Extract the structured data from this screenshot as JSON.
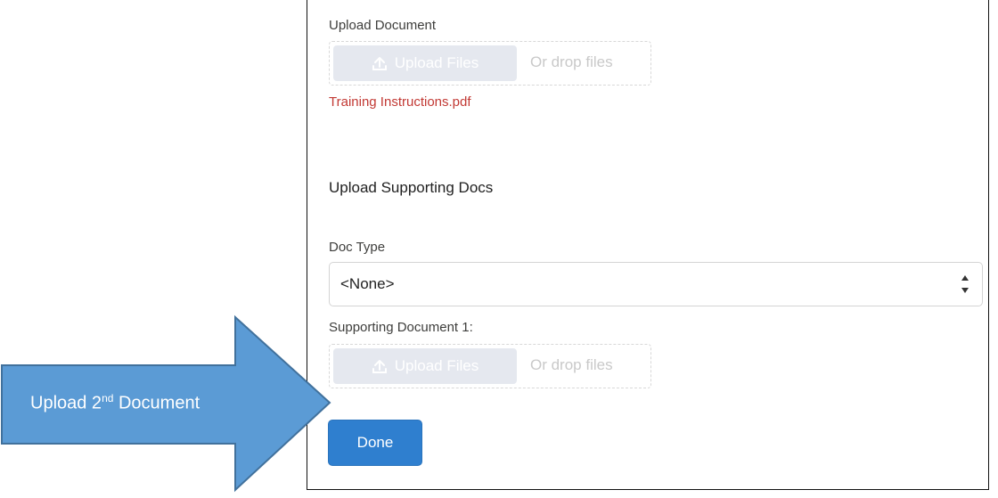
{
  "form": {
    "upload_document_label": "Upload Document",
    "upload_files_label": "Upload Files",
    "drop_files_text": "Or drop files",
    "uploaded_filename": "Training Instructions.pdf",
    "supporting_heading": "Upload Supporting Docs",
    "doc_type_label": "Doc Type",
    "doc_type_selected": "<None>",
    "supporting_doc_label": "Supporting Document 1:",
    "done_label": "Done"
  },
  "callout": {
    "text_prefix": "Upload 2",
    "text_sup": "nd",
    "text_suffix": " Document"
  },
  "colors": {
    "arrow_fill": "#5b9bd5",
    "arrow_stroke": "#41719c",
    "done_button": "#2f7fcf",
    "filename": "#c23934"
  },
  "icons": {
    "upload": "upload-icon",
    "select": "up-down-arrows-icon"
  }
}
